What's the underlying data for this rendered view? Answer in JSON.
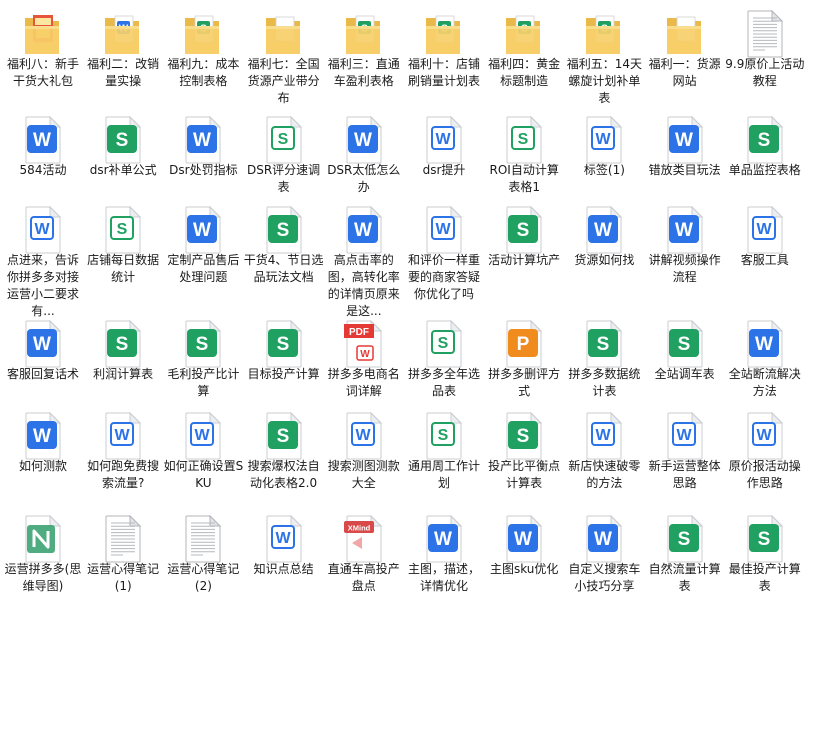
{
  "window": {
    "title": "",
    "view": "large-icons"
  },
  "colors": {
    "word": "#2b73e6",
    "sheet": "#20a162",
    "ppt": "#f08c1e",
    "pdf": "#e53935",
    "xmind": "#d84a4a",
    "mind": "#2f9e6a",
    "folder": "#f7cf6a"
  },
  "files": [
    [
      {
        "label": "福利八：新手干货大礼包",
        "type": "folder-book"
      },
      {
        "label": "福利二：改销量实操",
        "type": "folder-word"
      },
      {
        "label": "福利九：成本控制表格",
        "type": "folder-sheet"
      },
      {
        "label": "福利七：全国货源产业带分布",
        "type": "folder-plain"
      },
      {
        "label": "福利三：直通车盈利表格",
        "type": "folder-sheet"
      },
      {
        "label": "福利十：店铺刷销量计划表",
        "type": "folder-sheet"
      },
      {
        "label": "福利四：黄金标题制造",
        "type": "folder-sheet"
      },
      {
        "label": "福利五：14天螺旋计划补单表",
        "type": "folder-sheet"
      },
      {
        "label": "福利一：货源网站",
        "type": "folder-plain"
      },
      {
        "label": "9.9原价上活动教程",
        "type": "text"
      }
    ],
    [
      {
        "label": "584活动",
        "type": "word"
      },
      {
        "label": "dsr补单公式",
        "type": "sheet"
      },
      {
        "label": "Dsr处罚指标",
        "type": "word"
      },
      {
        "label": "DSR评分速调表",
        "type": "sheet-outline"
      },
      {
        "label": "DSR太低怎么办",
        "type": "word"
      },
      {
        "label": "dsr提升",
        "type": "word-outline"
      },
      {
        "label": "ROI自动计算表格1",
        "type": "sheet-outline"
      },
      {
        "label": "标签(1)",
        "type": "word-outline"
      },
      {
        "label": "错放类目玩法",
        "type": "word"
      },
      {
        "label": "单品监控表格",
        "type": "sheet"
      }
    ],
    [
      {
        "label": "点进来，告诉你拼多多对接运营小二要求有...",
        "type": "word-outline"
      },
      {
        "label": "店铺每日数据统计",
        "type": "sheet-outline"
      },
      {
        "label": "定制产品售后处理问题",
        "type": "word"
      },
      {
        "label": "干货4、节日选品玩法文档",
        "type": "sheet"
      },
      {
        "label": "高点击率的图，高转化率的详情页原来是这...",
        "type": "word"
      },
      {
        "label": "和评价一样重要的商家答疑你优化了吗",
        "type": "word-outline"
      },
      {
        "label": "活动计算坑产",
        "type": "sheet"
      },
      {
        "label": "货源如何找",
        "type": "word"
      },
      {
        "label": "讲解视频操作流程",
        "type": "word"
      },
      {
        "label": "客服工具",
        "type": "word-outline"
      }
    ],
    [
      {
        "label": "客服回复话术",
        "type": "word"
      },
      {
        "label": "利润计算表",
        "type": "sheet"
      },
      {
        "label": "毛利投产比计算",
        "type": "sheet"
      },
      {
        "label": "目标投产计算",
        "type": "sheet"
      },
      {
        "label": "拼多多电商名词详解",
        "type": "pdf"
      },
      {
        "label": "拼多多全年选品表",
        "type": "sheet-outline"
      },
      {
        "label": "拼多多删评方式",
        "type": "ppt"
      },
      {
        "label": "拼多多数据统计表",
        "type": "sheet"
      },
      {
        "label": "全站调车表",
        "type": "sheet"
      },
      {
        "label": "全站断流解决方法",
        "type": "word"
      }
    ],
    [
      {
        "label": "如何测款",
        "type": "word"
      },
      {
        "label": "如何跑免费搜索流量?",
        "type": "word-outline"
      },
      {
        "label": "如何正确设置SKU",
        "type": "word-outline"
      },
      {
        "label": "搜索爆权法自动化表格2.0",
        "type": "sheet"
      },
      {
        "label": "搜索测图测款大全",
        "type": "word-outline"
      },
      {
        "label": "通用周工作计划",
        "type": "sheet-outline"
      },
      {
        "label": "投产比平衡点计算表",
        "type": "sheet"
      },
      {
        "label": "新店快速破零的方法",
        "type": "word-outline"
      },
      {
        "label": "新手运营整体思路",
        "type": "word-outline"
      },
      {
        "label": "原价报活动操作思路",
        "type": "word-outline"
      }
    ],
    [
      {
        "label": "运营拼多多(思维导图)",
        "type": "mind"
      },
      {
        "label": "运营心得笔记(1)",
        "type": "text"
      },
      {
        "label": "运营心得笔记(2)",
        "type": "text"
      },
      {
        "label": "知识点总结",
        "type": "word-outline"
      },
      {
        "label": "直通车高投产盘点",
        "type": "xmind"
      },
      {
        "label": "主图，描述，详情优化",
        "type": "word"
      },
      {
        "label": "主图sku优化",
        "type": "word"
      },
      {
        "label": "自定义搜索车小技巧分享",
        "type": "word"
      },
      {
        "label": "自然流量计算表",
        "type": "sheet"
      },
      {
        "label": "最佳投产计算表",
        "type": "sheet"
      }
    ]
  ]
}
